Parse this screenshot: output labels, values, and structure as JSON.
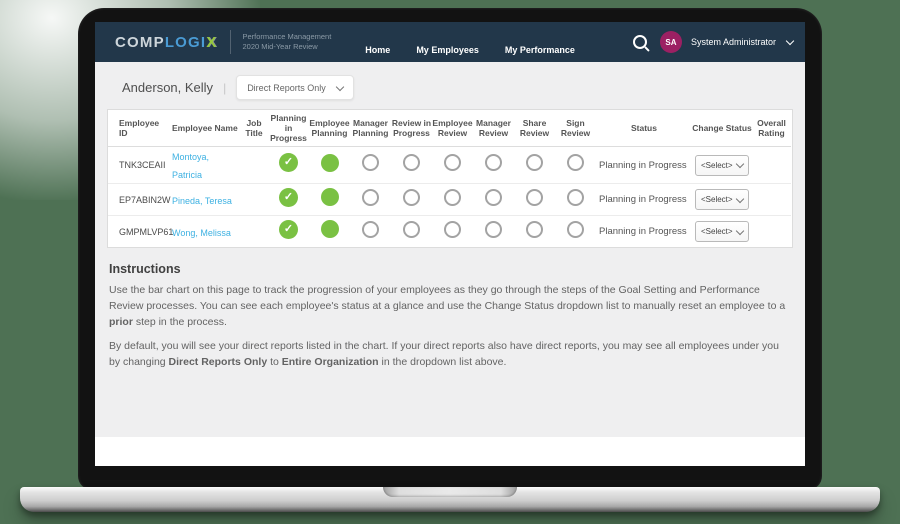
{
  "header": {
    "logo": {
      "part1": "COMP",
      "part2": "LOGI",
      "part3": "X"
    },
    "subtitle_line1": "Performance Management",
    "subtitle_line2": "2020 Mid-Year Review",
    "nav": [
      {
        "label": "Home"
      },
      {
        "label": "My Employees"
      },
      {
        "label": "My Performance"
      }
    ],
    "user": {
      "initials": "SA",
      "name": "System Administrator"
    }
  },
  "toolbar": {
    "manager_name": "Anderson, Kelly",
    "separator": "|",
    "filter_value": "Direct Reports Only"
  },
  "table": {
    "columns": [
      "Employee ID",
      "Employee Name",
      "Job Title",
      "Planning in Progress",
      "Employee Planning",
      "Manager Planning",
      "Review in Progress",
      "Employee Review",
      "Manager Review",
      "Share Review",
      "Sign Review",
      "Status",
      "Change Status",
      "Overall Rating"
    ],
    "rows": [
      {
        "id": "TNK3CEAII",
        "name": "Montoya, Patricia",
        "job_title": "",
        "steps": [
          "done",
          "active",
          "empty",
          "empty",
          "empty",
          "empty",
          "empty",
          "empty"
        ],
        "status": "Planning in Progress",
        "change_status": "<Select>",
        "overall_rating": ""
      },
      {
        "id": "EP7ABIN2W",
        "name": "Pineda, Teresa",
        "job_title": "",
        "steps": [
          "done",
          "active",
          "empty",
          "empty",
          "empty",
          "empty",
          "empty",
          "empty"
        ],
        "status": "Planning in Progress",
        "change_status": "<Select>",
        "overall_rating": ""
      },
      {
        "id": "GMPMLVP61",
        "name": "Wong, Melissa",
        "job_title": "",
        "steps": [
          "done",
          "active",
          "empty",
          "empty",
          "empty",
          "empty",
          "empty",
          "empty"
        ],
        "status": "Planning in Progress",
        "change_status": "<Select>",
        "overall_rating": ""
      }
    ]
  },
  "instructions": {
    "title": "Instructions",
    "p1": [
      {
        "t": "Use the bar chart on this page to track the progression of your employees as they go through the steps of the Goal Setting and Performance Review processes. You can see each employee's status at a glance and use the Change Status dropdown list to manually reset an employee to a "
      },
      {
        "t": "prior",
        "b": true
      },
      {
        "t": " step in the process."
      }
    ],
    "p2": [
      {
        "t": "By default, you will see your direct reports listed in the chart. If your direct reports also have direct reports, you may see all employees under you by changing "
      },
      {
        "t": "Direct Reports Only",
        "b": true
      },
      {
        "t": " to "
      },
      {
        "t": "Entire Organization",
        "b": true
      },
      {
        "t": " in the dropdown list above."
      }
    ]
  },
  "colors": {
    "header_bg": "#22374a",
    "accent_green": "#7ac143",
    "link_blue": "#3eb1e2",
    "avatar_bg": "#9c2063",
    "logo_blue": "#4a9bd4",
    "logo_green": "#97c93d",
    "background_green": "#4e7154",
    "page_bg": "#efeff0"
  }
}
